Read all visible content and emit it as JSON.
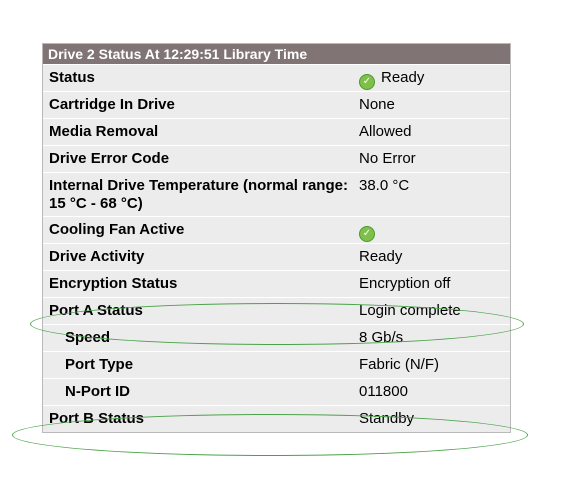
{
  "header": {
    "title": "Drive 2 Status At 12:29:51 Library Time"
  },
  "rows": [
    {
      "label": "Status",
      "value": "Ready",
      "icon": "check-icon"
    },
    {
      "label": "Cartridge In Drive",
      "value": "None"
    },
    {
      "label": "Media Removal",
      "value": "Allowed"
    },
    {
      "label": "Drive Error Code",
      "value": "No Error"
    },
    {
      "label": "Internal Drive Temperature (normal range: 15 °C - 68 °C)",
      "value": "38.0 °C"
    },
    {
      "label": "Cooling Fan Active",
      "value": "",
      "icon": "check-icon"
    },
    {
      "label": "Drive Activity",
      "value": "Ready"
    },
    {
      "label": "Encryption Status",
      "value": "Encryption off"
    },
    {
      "label": "Port A Status",
      "value": "Login complete",
      "highlighted": true
    },
    {
      "label": "Speed",
      "value": "8 Gb/s",
      "indent": true
    },
    {
      "label": "Port Type",
      "value": "Fabric (N/F)",
      "indent": true
    },
    {
      "label": "N-Port ID",
      "value": "011800",
      "indent": true
    },
    {
      "label": "Port B Status",
      "value": "Standby",
      "highlighted": true
    }
  ],
  "colors": {
    "header_bg": "#817474",
    "row_bg": "#ececec",
    "highlight_ellipse": "#4aa24a",
    "check_icon": "#7ec04a"
  }
}
